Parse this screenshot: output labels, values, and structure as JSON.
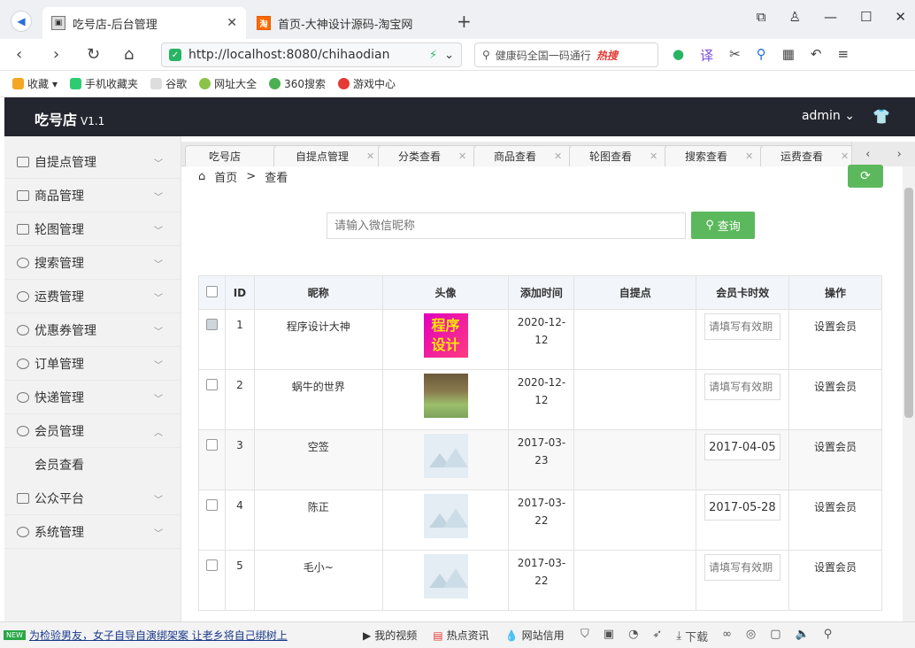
{
  "browser": {
    "tabs": [
      {
        "title": "吃号店-后台管理"
      },
      {
        "title": "首页-大神设计源码-淘宝网",
        "favicon": "淘"
      }
    ],
    "url": "http://localhost:8080/chihaodian",
    "search_placeholder": "健康码全国一码通行",
    "search_hot": "热搜",
    "bookmarks": [
      "收藏",
      "手机收藏夹",
      "谷歌",
      "网址大全",
      "360搜索",
      "游戏中心"
    ]
  },
  "app": {
    "brand": "吃号店",
    "version": "V1.1",
    "user": "admin"
  },
  "sidebar": {
    "items": [
      {
        "label": "自提点管理"
      },
      {
        "label": "商品管理"
      },
      {
        "label": "轮图管理"
      },
      {
        "label": "搜索管理"
      },
      {
        "label": "运费管理"
      },
      {
        "label": "优惠券管理"
      },
      {
        "label": "订单管理"
      },
      {
        "label": "快递管理"
      },
      {
        "label": "会员管理"
      },
      {
        "label": "公众平台"
      },
      {
        "label": "系统管理"
      }
    ],
    "sub_items": [
      {
        "label": "会员查看"
      }
    ]
  },
  "page_tabs": [
    "吃号店",
    "自提点管理",
    "分类查看",
    "商品查看",
    "轮图查看",
    "搜索查看",
    "运费查看"
  ],
  "breadcrumb": {
    "home": "首页",
    "sep": ">",
    "current": "查看"
  },
  "search": {
    "placeholder": "请输入微信昵称",
    "button": "查询"
  },
  "table": {
    "headers": [
      "ID",
      "昵称",
      "头像",
      "添加时间",
      "自提点",
      "会员卡时效",
      "操作"
    ],
    "card_placeholder": "请填写有效期",
    "action_label": "设置会员",
    "avatar_text": [
      "程序",
      "设计"
    ],
    "rows": [
      {
        "id": "1",
        "nickname": "程序设计大神",
        "date": "2020-12-12",
        "pickup": "",
        "card": ""
      },
      {
        "id": "2",
        "nickname": "蜗牛的世界",
        "date": "2020-12-12",
        "pickup": "",
        "card": ""
      },
      {
        "id": "3",
        "nickname": "空签",
        "date": "2017-03-23",
        "pickup": "",
        "card": "2017-04-05"
      },
      {
        "id": "4",
        "nickname": "陈正",
        "date": "2017-03-22",
        "pickup": "",
        "card": "2017-05-28"
      },
      {
        "id": "5",
        "nickname": "毛小~",
        "date": "2017-03-22",
        "pickup": "",
        "card": ""
      }
    ]
  },
  "statusbar": {
    "badge": "NEW",
    "news": "为检验男友，女子自导自演绑架案 让老乡将自己绑树上",
    "items": [
      "我的视频",
      "热点资讯",
      "网站信用",
      "下载"
    ]
  },
  "colors": {
    "header_bg": "#23262e",
    "accent_green": "#5cb85c"
  }
}
